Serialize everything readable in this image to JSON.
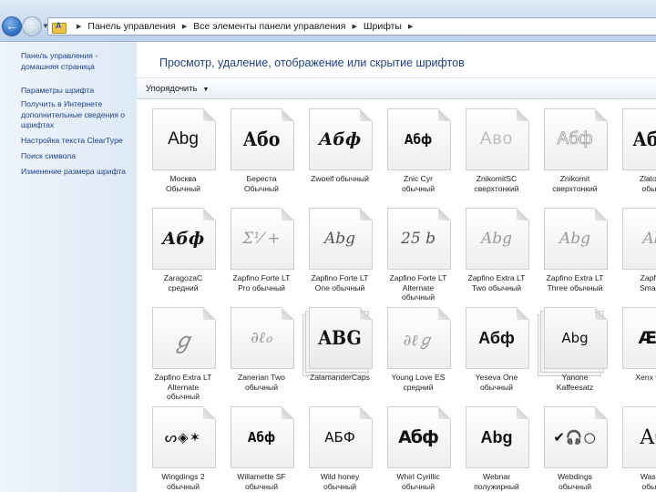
{
  "address_bar": {
    "breadcrumbs": [
      "Панель управления",
      "Все элементы панели управления",
      "Шрифты"
    ]
  },
  "sidebar": {
    "home_link": "Панель управления - домашняя страница",
    "links": [
      "Параметры шрифта",
      "Получить в Интернете дополнительные сведения о шрифтах",
      "Настройка текста ClearType",
      "Поиск символа",
      "Изменение размера шрифта"
    ]
  },
  "main": {
    "heading": "Просмотр, удаление, отображение или скрытие шрифтов",
    "organize_label": "Упорядочить"
  },
  "fonts": [
    {
      "sample": "Abg",
      "name": [
        "Москва",
        "Обычный"
      ],
      "style": "s-sans"
    },
    {
      "sample": "Або",
      "name": [
        "Береста",
        "Обычный"
      ],
      "style": "s-gothic"
    },
    {
      "sample": "Абф",
      "name": [
        "Zwoelf обычный"
      ],
      "style": "s-script"
    },
    {
      "sample": "Абф",
      "name": [
        "Znic Cyr",
        "обычный"
      ],
      "style": "s-cond"
    },
    {
      "sample": "Aвo",
      "name": [
        "ZnikomitSC",
        "сверхтонкий"
      ],
      "style": "s-light"
    },
    {
      "sample": "Aбф",
      "name": [
        "Znikomit",
        "сверхтонкий"
      ],
      "style": "s-outline"
    },
    {
      "sample": "Абф",
      "name": [
        "Zlatoust",
        "обычн"
      ],
      "style": "s-gothic"
    },
    {
      "sample": "Абф",
      "name": [
        "ZaragozaC",
        "средний"
      ],
      "style": "s-script"
    },
    {
      "sample": "Σ⅟ +",
      "name": [
        "Zapfino Forte LT",
        "Pro обычный"
      ],
      "style": "s-faint"
    },
    {
      "sample": "Abg",
      "name": [
        "Zapfino Forte LT",
        "One обычный"
      ],
      "style": "s-italic"
    },
    {
      "sample": "25 b",
      "name": [
        "Zapfino Forte LT",
        "Alternate",
        "обычный"
      ],
      "style": "s-italic"
    },
    {
      "sample": "Abg",
      "name": [
        "Zapfino Extra LT",
        "Two обычный"
      ],
      "style": "s-faint"
    },
    {
      "sample": "Abg",
      "name": [
        "Zapfino Extra LT",
        "Three обычный"
      ],
      "style": "s-faint"
    },
    {
      "sample": "Ab",
      "name": [
        "Zapfino",
        "Small C"
      ],
      "style": "s-faint"
    },
    {
      "sample": "ℊ",
      "name": [
        "Zapfino Extra LT",
        "Alternate",
        "обычный"
      ],
      "style": "s-squiggle"
    },
    {
      "sample": "∂ℓℴ",
      "name": [
        "Zanerian Two",
        "обычный"
      ],
      "style": "s-faint"
    },
    {
      "sample": "ABG",
      "name": [
        "ZalamanderCaps"
      ],
      "style": "s-gothic",
      "stacked": true
    },
    {
      "sample": "∂ℓℊ",
      "name": [
        "Young Love ES",
        "средний"
      ],
      "style": "s-faint"
    },
    {
      "sample": "Абф",
      "name": [
        "Yeseva One",
        "обычный"
      ],
      "style": "s-bold"
    },
    {
      "sample": "Abg",
      "name": [
        "Yanone",
        "Kaffeesatz"
      ],
      "style": "s-plain",
      "stacked": true
    },
    {
      "sample": "ÆБ",
      "name": [
        "Xenx wins"
      ],
      "style": "s-blackwide"
    },
    {
      "sample": "ᔕ◈✶",
      "name": [
        "Wingdings 2",
        "обычный"
      ],
      "style": "s-symbol"
    },
    {
      "sample": "Абф",
      "name": [
        "Willamette SF",
        "обычный"
      ],
      "style": "s-cond"
    },
    {
      "sample": "AБФ",
      "name": [
        "Wild honey",
        "обычный"
      ],
      "style": "s-plain"
    },
    {
      "sample": "Абф",
      "name": [
        "Whirl Cyrillic",
        "обычный"
      ],
      "style": "s-blackwide"
    },
    {
      "sample": "Abg",
      "name": [
        "Webnar",
        "полужирный"
      ],
      "style": "s-bold"
    },
    {
      "sample": "✔🎧○",
      "name": [
        "Webdings",
        "обычный"
      ],
      "style": "s-symbol"
    },
    {
      "sample": "Аб",
      "name": [
        "Washin",
        "обычн"
      ],
      "style": "s-serifbig"
    }
  ],
  "colors": {
    "link": "#1e3f8c",
    "sidebar_bg": "#dde9f6",
    "topbar_bg": "#c8d9ee"
  }
}
